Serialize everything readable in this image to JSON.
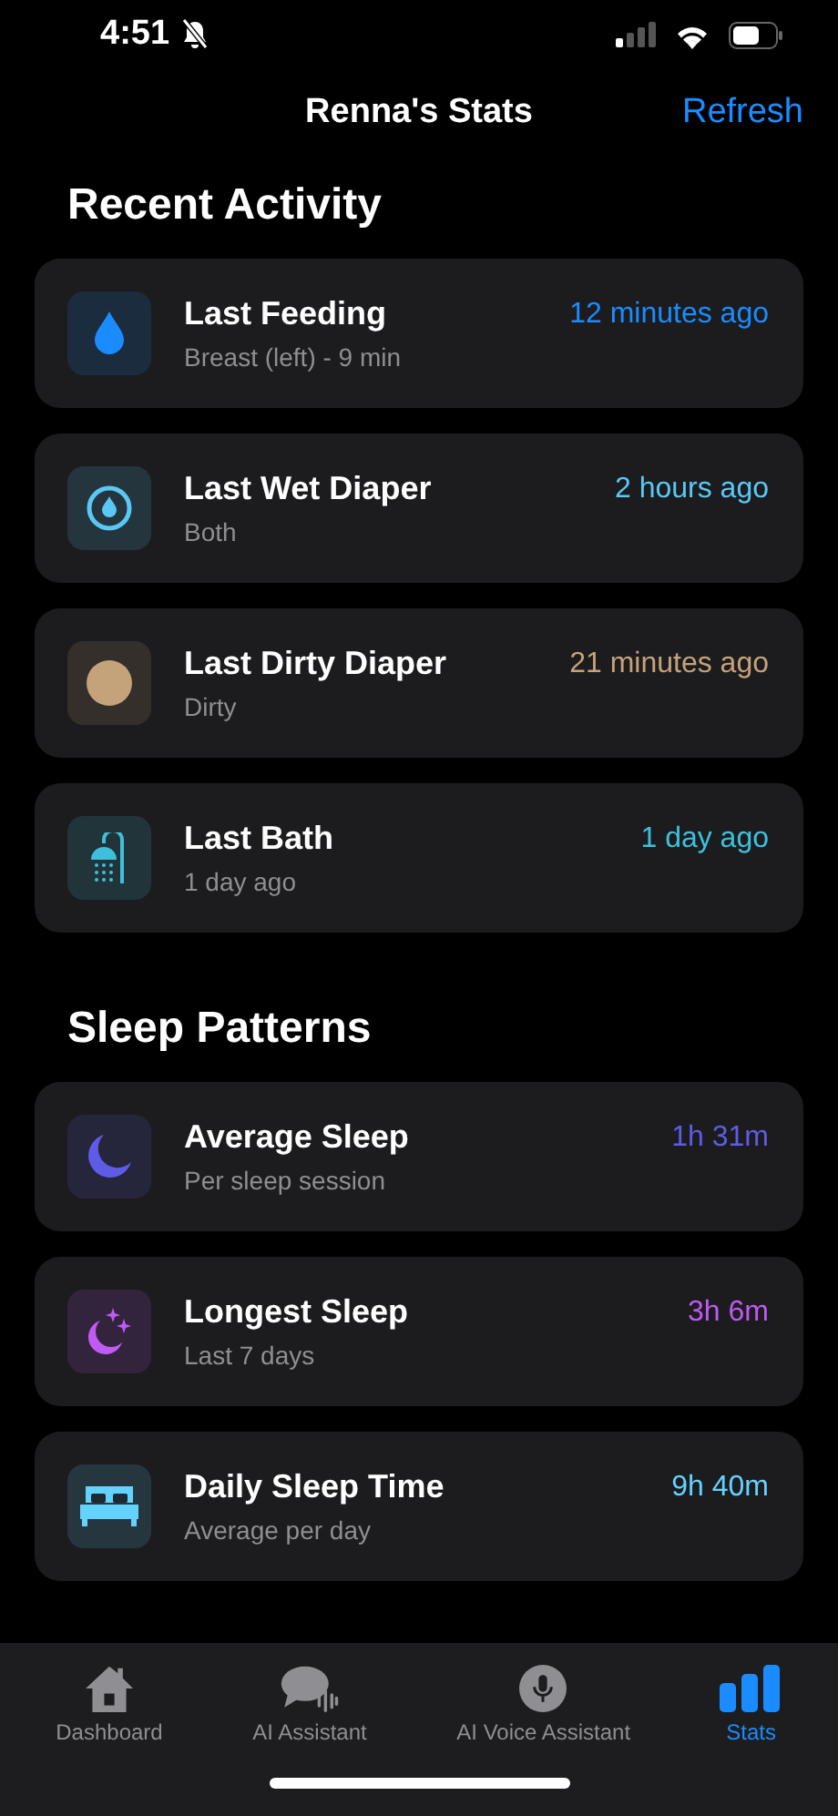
{
  "status_bar": {
    "time": "4:51"
  },
  "nav": {
    "title": "Renna's Stats",
    "action": "Refresh"
  },
  "sections": [
    {
      "title": "Recent Activity",
      "items": [
        {
          "kind": "drop",
          "title": "Last Feeding",
          "subtitle": "Breast (left) - 9 min",
          "value": "12 minutes ago",
          "color": "#1a8cff"
        },
        {
          "kind": "wet",
          "title": "Last Wet Diaper",
          "subtitle": "Both",
          "value": "2 hours ago",
          "color": "#5ac8f5"
        },
        {
          "kind": "dirty",
          "title": "Last Dirty Diaper",
          "subtitle": "Dirty",
          "value": "21 minutes ago",
          "color": "#c4a27a"
        },
        {
          "kind": "bath",
          "title": "Last Bath",
          "subtitle": "1 day ago",
          "value": "1 day ago",
          "color": "#3ec0dc"
        }
      ]
    },
    {
      "title": "Sleep Patterns",
      "items": [
        {
          "kind": "moon",
          "title": "Average Sleep",
          "subtitle": "Per sleep session",
          "value": "1h 31m",
          "color": "#5e5ce6"
        },
        {
          "kind": "moon-stars",
          "title": "Longest Sleep",
          "subtitle": "Last 7 days",
          "value": "3h 6m",
          "color": "#bf5af2"
        },
        {
          "kind": "bed",
          "title": "Daily Sleep Time",
          "subtitle": "Average per day",
          "value": "9h 40m",
          "color": "#64d2ff"
        }
      ]
    }
  ],
  "tabs": [
    {
      "kind": "home",
      "label": "Dashboard",
      "selected": false
    },
    {
      "kind": "chat",
      "label": "AI Assistant",
      "selected": false
    },
    {
      "kind": "mic",
      "label": "AI Voice Assistant",
      "selected": false
    },
    {
      "kind": "stats",
      "label": "Stats",
      "selected": true
    }
  ]
}
